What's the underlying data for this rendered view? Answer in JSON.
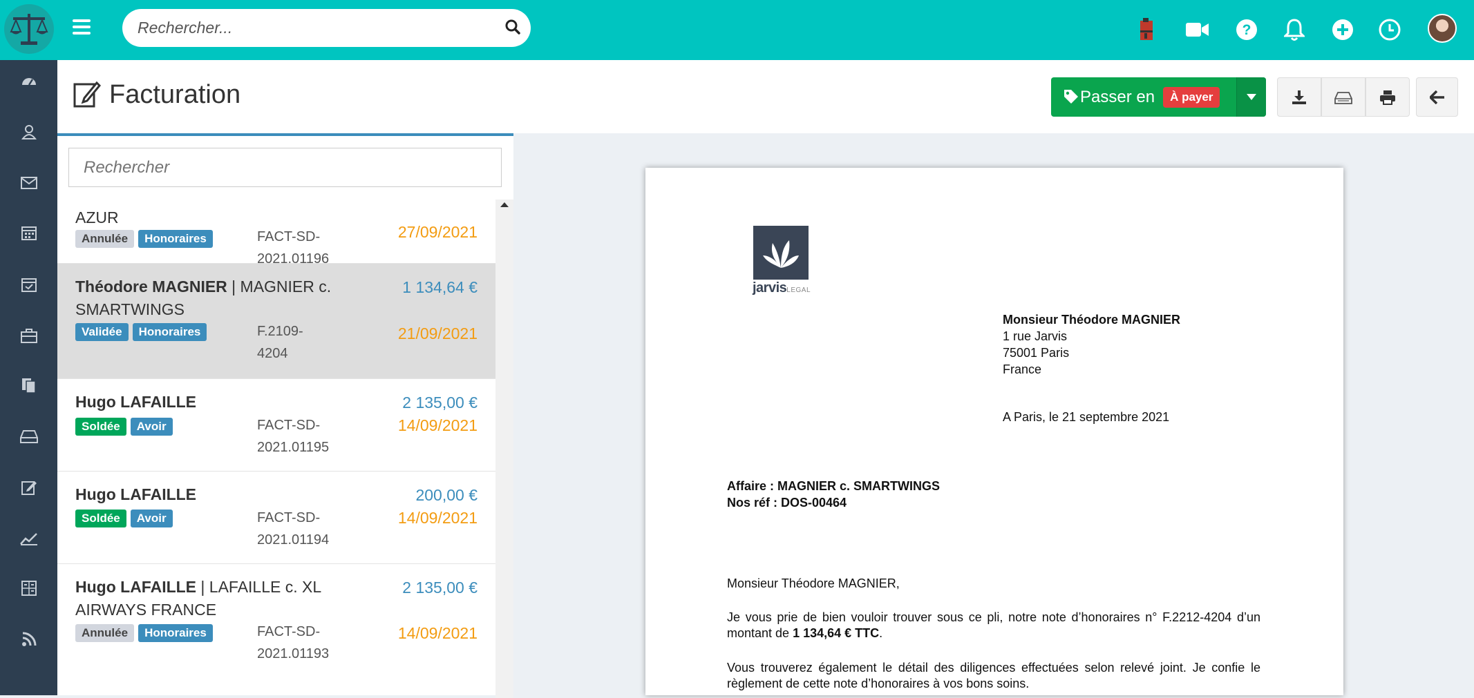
{
  "topbar": {
    "search_placeholder": "Rechercher...",
    "icons": [
      "scales-logo-icon",
      "menu-icon",
      "search-icon",
      "binder-icon",
      "video-icon",
      "help-icon",
      "bell-icon",
      "plus-icon",
      "clock-icon",
      "user-avatar"
    ]
  },
  "sidebar": {
    "items": [
      "dashboard-icon",
      "contacts-icon",
      "mail-icon",
      "calendar-icon",
      "tasks-icon",
      "briefcase-icon",
      "documents-icon",
      "inbox-icon",
      "billing-icon",
      "stats-icon",
      "calculator-icon",
      "rss-icon"
    ]
  },
  "header": {
    "title": "Facturation",
    "passer_label": "Passer en",
    "passer_badge": "À payer"
  },
  "list": {
    "search_placeholder": "Rechercher",
    "items": [
      {
        "name_bold": "",
        "name_rest": "AZUR",
        "tags": [
          "Annulée",
          "Honoraires"
        ],
        "ref": "FACT-SD-2021.01196",
        "amount": "",
        "date": "27/09/2021"
      },
      {
        "name_bold": "Théodore MAGNIER",
        "name_rest": " | MAGNIER c. SMARTWINGS",
        "tags": [
          "Validée",
          "Honoraires"
        ],
        "ref": "F.2109-4204",
        "amount": "1 134,64 €",
        "date": "21/09/2021"
      },
      {
        "name_bold": "Hugo LAFAILLE",
        "name_rest": "",
        "tags": [
          "Soldée",
          "Avoir"
        ],
        "ref": "FACT-SD-2021.01195",
        "amount": "2 135,00 €",
        "date": "14/09/2021"
      },
      {
        "name_bold": "Hugo LAFAILLE",
        "name_rest": "",
        "tags": [
          "Soldée",
          "Avoir"
        ],
        "ref": "FACT-SD-2021.01194",
        "amount": "200,00 €",
        "date": "14/09/2021"
      },
      {
        "name_bold": "Hugo LAFAILLE",
        "name_rest": " | LAFAILLE c. XL AIRWAYS FRANCE",
        "tags": [
          "Annulée",
          "Honoraires"
        ],
        "ref": "FACT-SD-2021.01193",
        "amount": "2 135,00 €",
        "date": "14/09/2021"
      }
    ]
  },
  "document": {
    "logo_text": "jarvis",
    "logo_sub": "LEGAL",
    "recipient_name": "Monsieur Théodore MAGNIER",
    "recipient_street": "1 rue Jarvis",
    "recipient_city": "75001 Paris",
    "recipient_country": "France",
    "place_date": "A Paris, le 21 septembre 2021",
    "affaire": "Affaire : MAGNIER c. SMARTWINGS",
    "ref": "Nos réf : DOS-00464",
    "greeting": "Monsieur Théodore MAGNIER,",
    "para1_a": "Je vous prie de bien vouloir trouver sous ce pli, notre note d’honoraires n° F.2212-4204 d’un montant de ",
    "para1_amount": "1 134,64 € TTC",
    "para1_end": ".",
    "para2": "Vous trouverez également le détail des diligences effectuées selon relevé joint. Je confie le règlement de cette note d’honoraires à vos bons soins."
  },
  "colors": {
    "topbar": "#00c5c0",
    "sidebar": "#2d3e50",
    "success": "#0aa54e",
    "danger": "#e53e3e",
    "amount": "#3c8dbc",
    "date": "#f39c12"
  }
}
